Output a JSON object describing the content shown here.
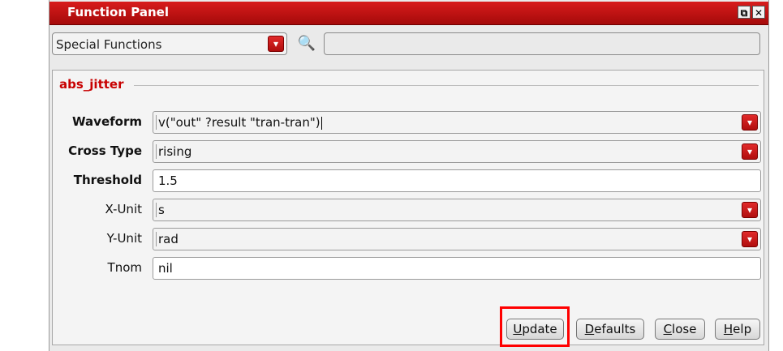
{
  "window": {
    "title": "Function Panel",
    "restore_glyph": "⧉",
    "close_glyph": "✕"
  },
  "toolbar": {
    "category_value": "Special Functions",
    "dropdown_glyph": "▾",
    "search_glyph": "🔍",
    "search_value": ""
  },
  "function_group": {
    "title": "abs_jitter",
    "fields": [
      {
        "label": "Waveform",
        "value": "v(\"out\" ?result \"tran-tran\")",
        "bold": true,
        "type": "combo"
      },
      {
        "label": "Cross Type",
        "value": "rising",
        "bold": true,
        "type": "combo"
      },
      {
        "label": "Threshold",
        "value": "1.5",
        "bold": true,
        "type": "text"
      },
      {
        "label": "X-Unit",
        "value": "s",
        "bold": false,
        "type": "combo"
      },
      {
        "label": "Y-Unit",
        "value": "rad",
        "bold": false,
        "type": "combo"
      },
      {
        "label": "Tnom",
        "value": "nil",
        "bold": false,
        "type": "text"
      }
    ]
  },
  "buttons": {
    "update": {
      "first": "U",
      "rest": "pdate"
    },
    "defaults": {
      "first": "D",
      "rest": "efaults"
    },
    "close": {
      "first": "C",
      "rest": "lose"
    },
    "help": {
      "first": "H",
      "rest": "elp"
    }
  },
  "colors": {
    "titlebar": "#c41212",
    "label_accent": "#c80000",
    "highlight": "#ff0000"
  }
}
